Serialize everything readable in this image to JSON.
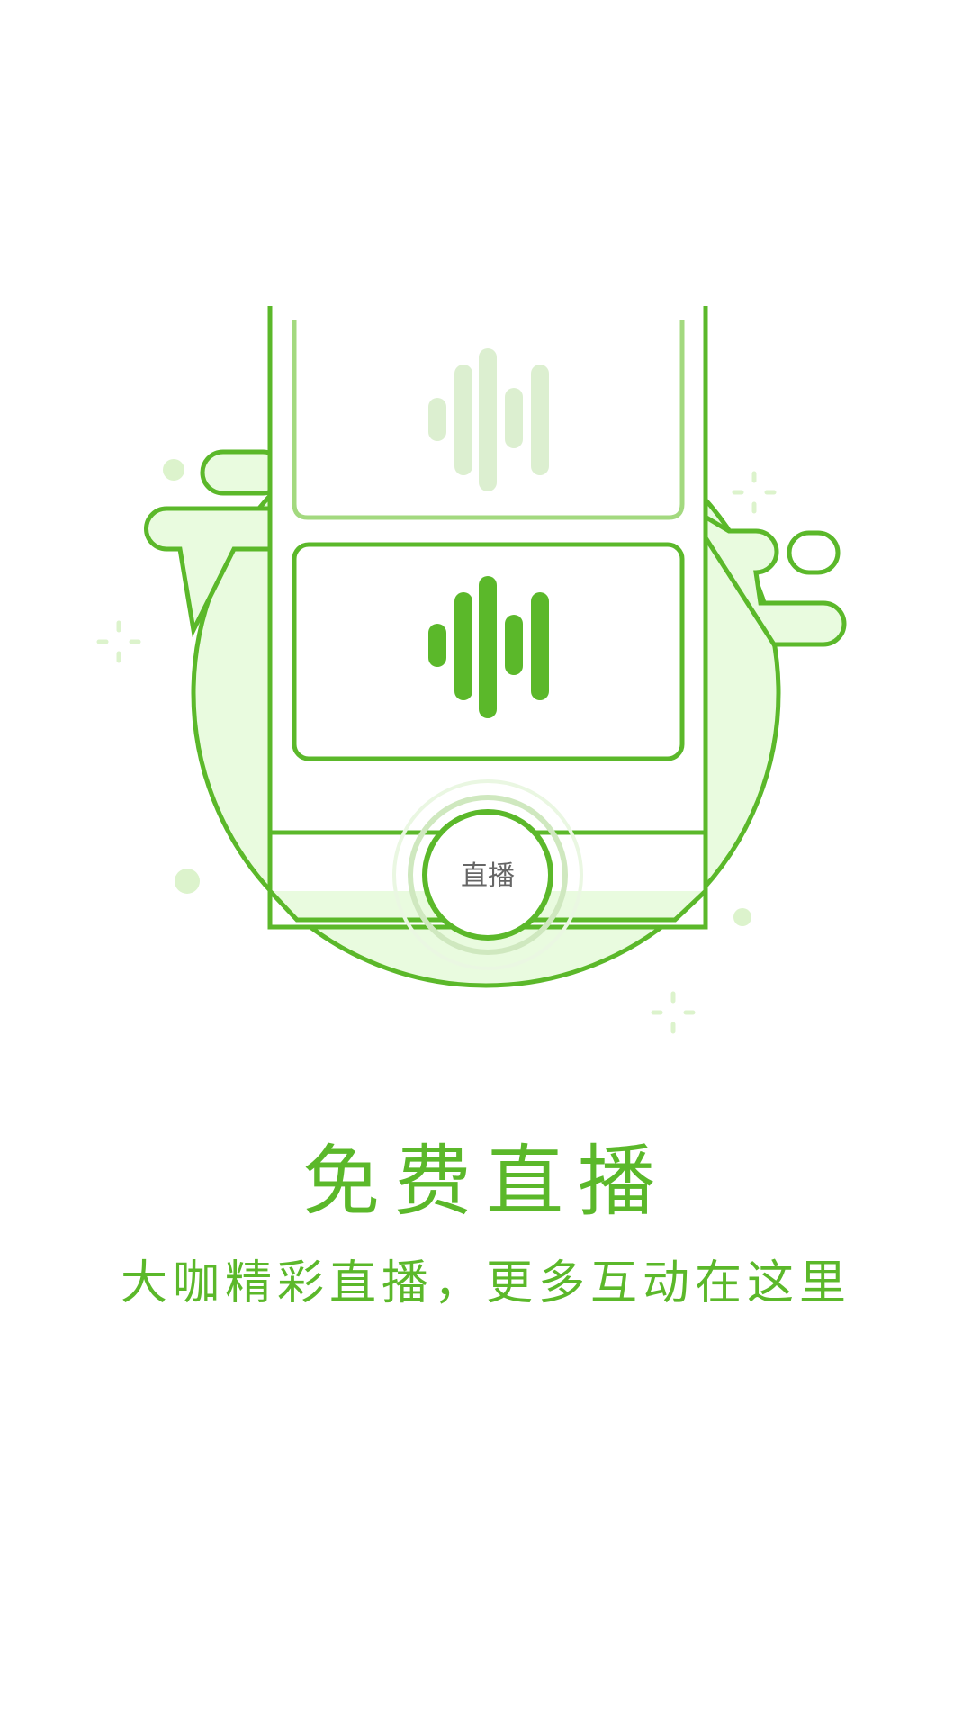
{
  "illustration": {
    "button_label": "直播",
    "colors": {
      "primary_green": "#5bb82a",
      "light_green": "#a3d97f",
      "pale_green": "#e9fbdf",
      "faded_green": "#dcefd0",
      "button_text": "#666666"
    },
    "icons": [
      "waveform-icon",
      "sparkle-icon"
    ]
  },
  "intro": {
    "title": "免费直播",
    "subtitle": "大咖精彩直播，更多互动在这里"
  }
}
